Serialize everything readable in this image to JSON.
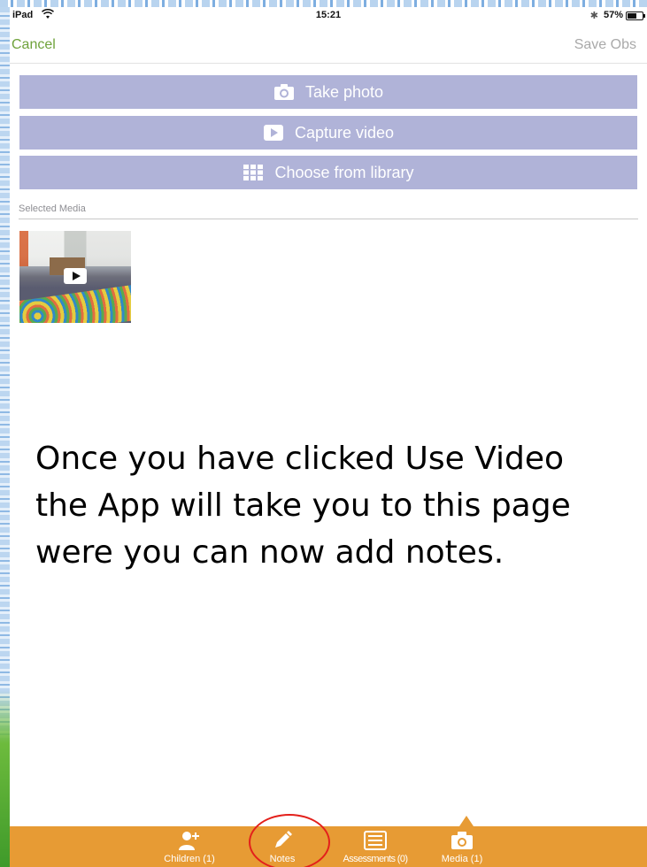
{
  "status_bar": {
    "carrier": "iPad",
    "time": "15:21",
    "battery": "57%"
  },
  "nav": {
    "cancel": "Cancel",
    "save": "Save Obs"
  },
  "actions": {
    "take_photo": "Take photo",
    "capture_video": "Capture video",
    "choose_library": "Choose from library"
  },
  "selected_media": {
    "label": "Selected Media"
  },
  "caption": {
    "line1": "Once you have clicked Use Video",
    "line2": "the App will take you to this page",
    "line3": "were you can now add notes."
  },
  "tabs": {
    "children": "Children (1)",
    "notes": "Notes",
    "assessments": "Assessments (0)",
    "media": "Media (1)"
  },
  "colors": {
    "accent_green": "#6fa23b",
    "action_button": "#b0b3d8",
    "tabbar_orange": "#e79b34",
    "annotation_red": "#e3201b"
  }
}
